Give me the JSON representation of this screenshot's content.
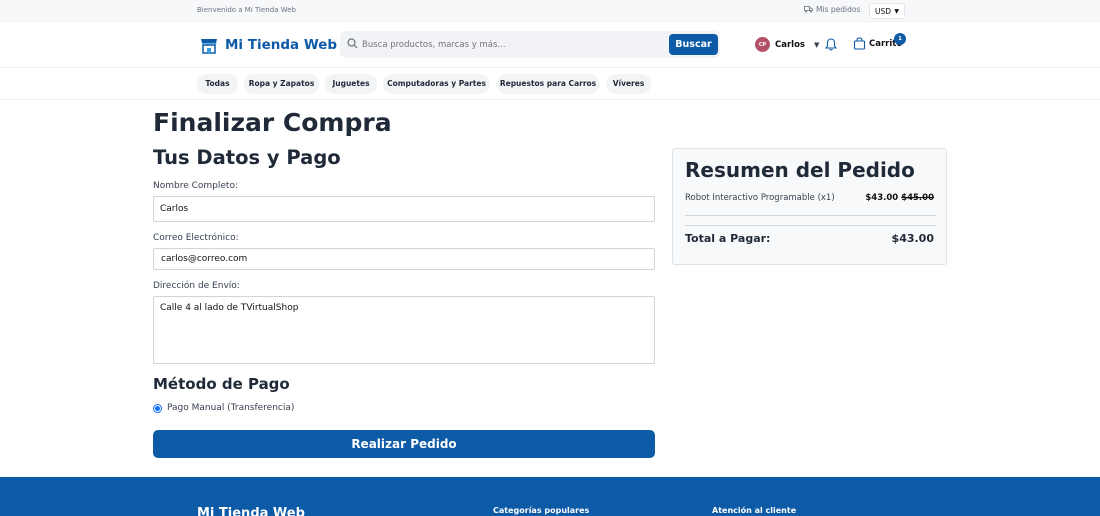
{
  "topbar": {
    "welcome": "Bienvenido a Mi Tienda Web",
    "orders_label": "Mis pedidos",
    "currency": "USD"
  },
  "header": {
    "brand": "Mi Tienda Web",
    "search_placeholder": "Busca productos, marcas y más...",
    "search_button": "Buscar",
    "user_initials": "CP",
    "user_name": "Carlos",
    "cart_label": "Carrito",
    "cart_count": "1"
  },
  "categories": [
    {
      "label": "Todas"
    },
    {
      "label": "Ropa y Zapatos"
    },
    {
      "label": "Juguetes"
    },
    {
      "label": "Computadoras y Partes"
    },
    {
      "label": "Repuestos para Carros"
    },
    {
      "label": "Víveres"
    }
  ],
  "checkout": {
    "title": "Finalizar Compra",
    "section_title": "Tus Datos y Pago",
    "name_label": "Nombre Completo:",
    "name_value": "Carlos",
    "email_label": "Correo Electrónico:",
    "email_value": "carlos@correo.com",
    "address_label": "Dirección de Envío:",
    "address_value": "Calle 4 al lado de TVirtualShop",
    "payment_title": "Método de Pago",
    "payment_option": "Pago Manual (Transferencia)",
    "submit_label": "Realizar Pedido"
  },
  "summary": {
    "title": "Resumen del Pedido",
    "item_name": "Robot Interactivo Programable (x1)",
    "item_price": "$43.00",
    "item_old_price": "$45.00",
    "total_label": "Total a Pagar:",
    "total_value": "$43.00"
  },
  "footer": {
    "brand": "Mi Tienda Web",
    "col1": "Categorías populares",
    "col2": "Atención al cliente"
  },
  "colors": {
    "primary": "#0d5aa7",
    "avatar": "#b45168"
  }
}
